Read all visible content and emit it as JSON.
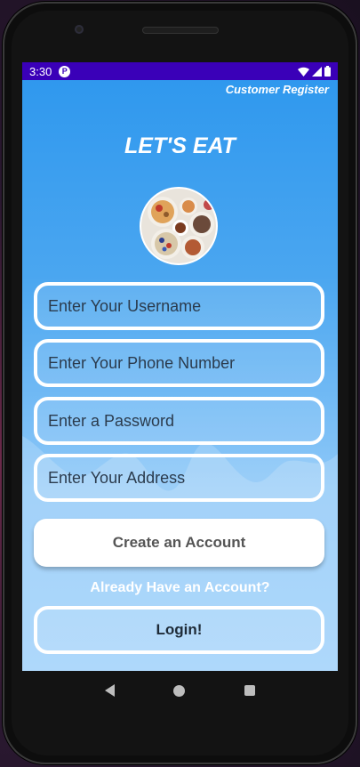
{
  "status_bar": {
    "time": "3:30",
    "notification_icon": "P"
  },
  "header": {
    "screen_label": "Customer Register"
  },
  "app": {
    "title": "LET'S EAT"
  },
  "form": {
    "username": {
      "placeholder": "Enter Your Username"
    },
    "phone": {
      "placeholder": "Enter Your Phone Number"
    },
    "password": {
      "placeholder": "Enter a Password"
    },
    "address": {
      "placeholder": "Enter Your Address"
    }
  },
  "actions": {
    "create_label": "Create an Account",
    "already_label": "Already Have an Account?",
    "login_label": "Login!"
  },
  "nav": {
    "icons": [
      "back-icon",
      "home-icon",
      "recents-icon"
    ]
  },
  "colors": {
    "status_bar": "#3a00b8",
    "gradient_top": "#2d97ee",
    "gradient_bottom": "#9dd0fa",
    "button_bg": "#ffffff"
  }
}
